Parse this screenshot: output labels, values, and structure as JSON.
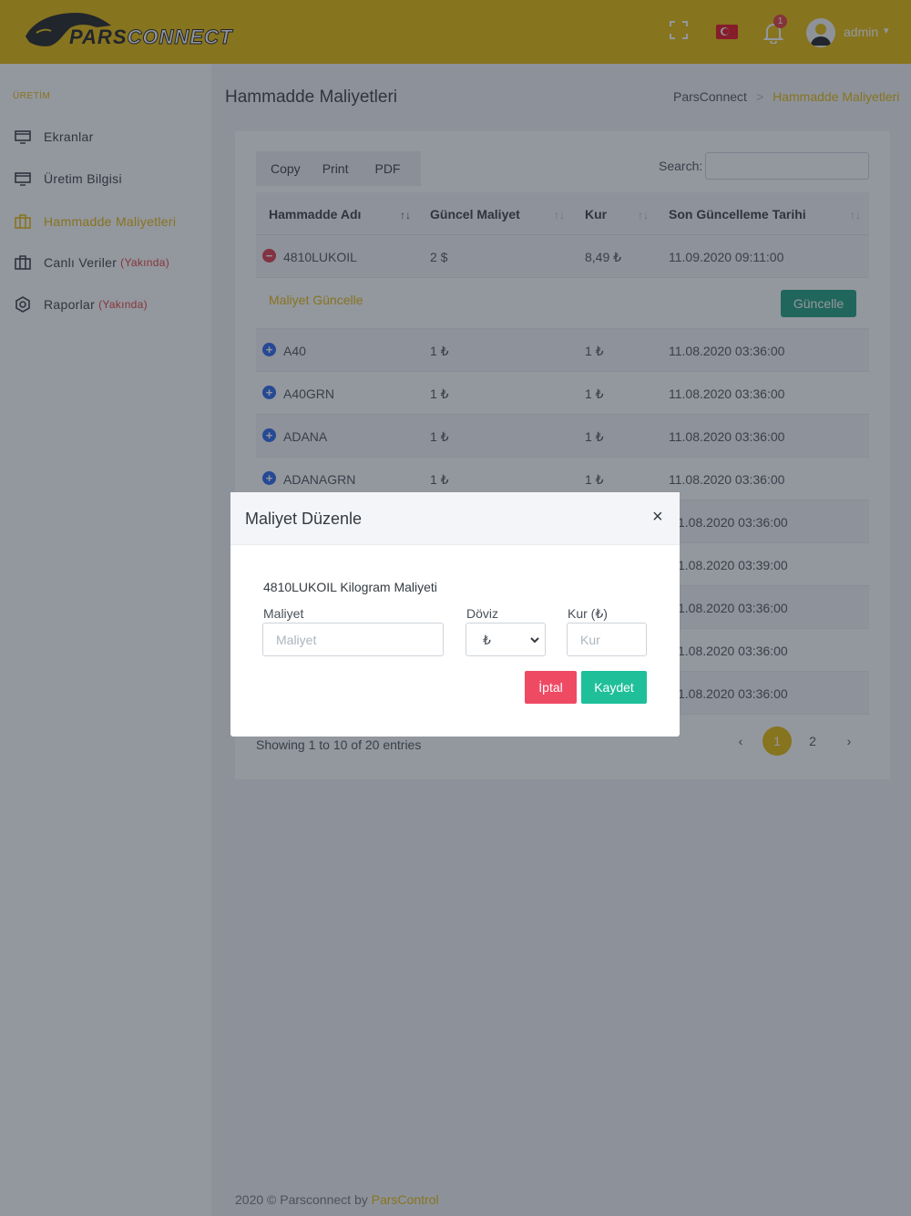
{
  "header": {
    "logo_text_a": "PARS",
    "logo_text_b": "CONNECT",
    "notification_count": "1",
    "user_name": "admin"
  },
  "sidebar": {
    "section_title": "ÜRETİM",
    "items": [
      {
        "label": "Ekranlar",
        "soon": ""
      },
      {
        "label": "Üretim Bilgisi",
        "soon": ""
      },
      {
        "label": "Hammadde Maliyetleri",
        "soon": ""
      },
      {
        "label": "Canlı Veriler",
        "soon": "(Yakında)"
      },
      {
        "label": "Raporlar",
        "soon": "(Yakında)"
      }
    ]
  },
  "page": {
    "title": "Hammadde Maliyetleri",
    "breadcrumb": {
      "root": "ParsConnect",
      "separator": ">",
      "current": "Hammadde Maliyetleri"
    }
  },
  "toolbar": {
    "copy": "Copy",
    "print": "Print",
    "pdf": "PDF",
    "search_label": "Search:"
  },
  "table": {
    "columns": [
      "Hammadde Adı",
      "Güncel Maliyet",
      "Kur",
      "Son Güncelleme Tarihi"
    ],
    "sort_glyph": "↑↓",
    "rows": [
      {
        "name": "4810LUKOIL",
        "cost": "2 $",
        "rate": "8,49 ₺",
        "date": "11.09.2020 09:11:00",
        "toggle": "−"
      },
      {
        "name": "A40",
        "cost": "1 ₺",
        "rate": "1 ₺",
        "date": "11.08.2020 03:36:00",
        "toggle": "+"
      },
      {
        "name": "A40GRN",
        "cost": "1 ₺",
        "rate": "1 ₺",
        "date": "11.08.2020 03:36:00",
        "toggle": "+"
      },
      {
        "name": "ADANA",
        "cost": "1 ₺",
        "rate": "1 ₺",
        "date": "11.08.2020 03:36:00",
        "toggle": "+"
      },
      {
        "name": "ADANAGRN",
        "cost": "1 ₺",
        "rate": "1 ₺",
        "date": "11.08.2020 03:36:00",
        "toggle": "+"
      },
      {
        "name": "",
        "cost": "",
        "rate": "",
        "date": "1.08.2020 03:36:00",
        "toggle": ""
      },
      {
        "name": "",
        "cost": "",
        "rate": "",
        "date": "1.08.2020 03:39:00",
        "toggle": ""
      },
      {
        "name": "",
        "cost": "",
        "rate": "",
        "date": "1.08.2020 03:36:00",
        "toggle": ""
      },
      {
        "name": "",
        "cost": "",
        "rate": "",
        "date": "1.08.2020 03:36:00",
        "toggle": ""
      },
      {
        "name": "",
        "cost": "",
        "rate": "",
        "date": "1.08.2020 03:36:00",
        "toggle": ""
      }
    ],
    "child_row": {
      "label": "Maliyet Güncelle",
      "button": "Güncelle"
    }
  },
  "pagination": {
    "showing": "Showing 1 to 10 of 20 entries",
    "prev": "‹",
    "pages": [
      "1",
      "2"
    ],
    "next": "›",
    "active_page": "1"
  },
  "footer": {
    "text": "2020 © Parsconnect by",
    "brand": "ParsControl"
  },
  "modal": {
    "title": "Maliyet Düzenle",
    "close": "×",
    "subtitle": "4810LUKOIL Kilogram Maliyeti",
    "cost_label": "Maliyet",
    "cost_placeholder": "Maliyet",
    "currency_label": "Döviz",
    "currency_value": "₺",
    "rate_label": "Kur (₺)",
    "rate_placeholder": "Kur",
    "cancel": "İptal",
    "save": "Kaydet"
  },
  "colors": {
    "brand": "#e6b800",
    "update_button": "#1a9c7a",
    "cancel_button": "#ef4a64",
    "save_button": "#1fbf9a",
    "danger": "#dc3545",
    "primary": "#2563eb"
  }
}
